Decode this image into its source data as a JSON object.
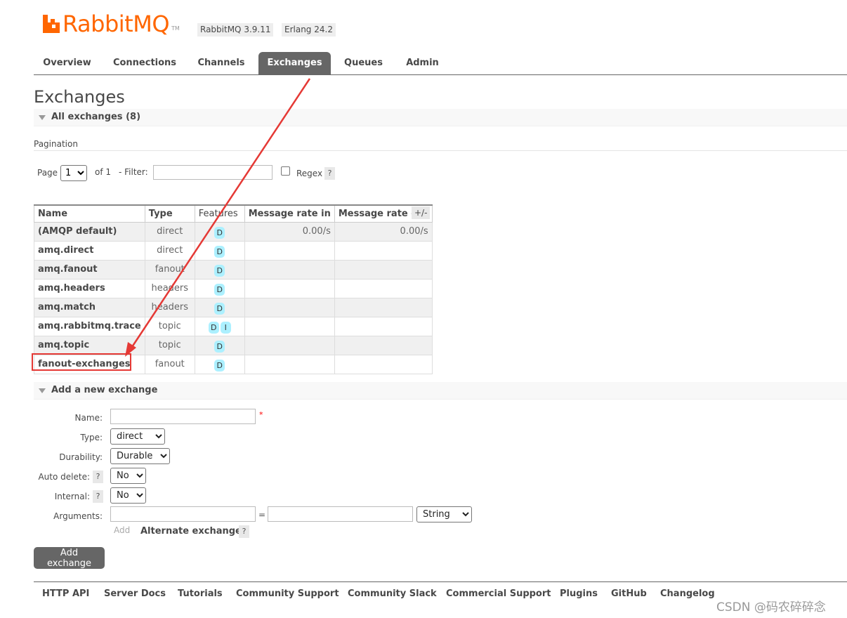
{
  "header": {
    "logo_text": "RabbitMQ",
    "logo_tm": "TM",
    "version": "RabbitMQ 3.9.11",
    "erlang": "Erlang 24.2"
  },
  "tabs": [
    {
      "label": "Overview",
      "active": false
    },
    {
      "label": "Connections",
      "active": false
    },
    {
      "label": "Channels",
      "active": false
    },
    {
      "label": "Exchanges",
      "active": true
    },
    {
      "label": "Queues",
      "active": false
    },
    {
      "label": "Admin",
      "active": false
    }
  ],
  "page_title": "Exchanges",
  "all_exchanges_section": "All exchanges (8)",
  "pagination": {
    "heading": "Pagination",
    "page_label": "Page",
    "page_value": "1",
    "of_label": "of 1",
    "filter_label": "- Filter:",
    "filter_value": "",
    "regex_label": "Regex",
    "help": "?"
  },
  "table": {
    "columns": [
      "Name",
      "Type",
      "Features",
      "Message rate in",
      "Message rate out"
    ],
    "toggle": "+/-",
    "rows": [
      {
        "name": "(AMQP default)",
        "type": "direct",
        "features": [
          "D"
        ],
        "rate_in": "0.00/s",
        "rate_out": "0.00/s"
      },
      {
        "name": "amq.direct",
        "type": "direct",
        "features": [
          "D"
        ],
        "rate_in": "",
        "rate_out": ""
      },
      {
        "name": "amq.fanout",
        "type": "fanout",
        "features": [
          "D"
        ],
        "rate_in": "",
        "rate_out": ""
      },
      {
        "name": "amq.headers",
        "type": "headers",
        "features": [
          "D"
        ],
        "rate_in": "",
        "rate_out": ""
      },
      {
        "name": "amq.match",
        "type": "headers",
        "features": [
          "D"
        ],
        "rate_in": "",
        "rate_out": ""
      },
      {
        "name": "amq.rabbitmq.trace",
        "type": "topic",
        "features": [
          "D",
          "I"
        ],
        "rate_in": "",
        "rate_out": ""
      },
      {
        "name": "amq.topic",
        "type": "topic",
        "features": [
          "D"
        ],
        "rate_in": "",
        "rate_out": ""
      },
      {
        "name": "fanout-exchanges",
        "type": "fanout",
        "features": [
          "D"
        ],
        "rate_in": "",
        "rate_out": ""
      }
    ]
  },
  "add_section": "Add a new exchange",
  "form": {
    "name_label": "Name:",
    "name_value": "",
    "required": "*",
    "type_label": "Type:",
    "type_value": "direct",
    "durability_label": "Durability:",
    "durability_value": "Durable",
    "auto_delete_label": "Auto delete:",
    "auto_delete_value": "No",
    "internal_label": "Internal:",
    "internal_value": "No",
    "arguments_label": "Arguments:",
    "arg_key": "",
    "equals": "=",
    "arg_value": "",
    "arg_type": "String",
    "add_link": "Add",
    "alternate_exchange": "Alternate exchange",
    "help": "?",
    "submit": "Add exchange"
  },
  "footer": [
    "HTTP API",
    "Server Docs",
    "Tutorials",
    "Community Support",
    "Community Slack",
    "Commercial Support",
    "Plugins",
    "GitHub",
    "Changelog"
  ],
  "watermark": "CSDN @码农碎碎念",
  "colors": {
    "brand": "#ff6600",
    "active_tab": "#666666",
    "feature_badge": "#acf0ff",
    "annotation": "#e53935"
  }
}
